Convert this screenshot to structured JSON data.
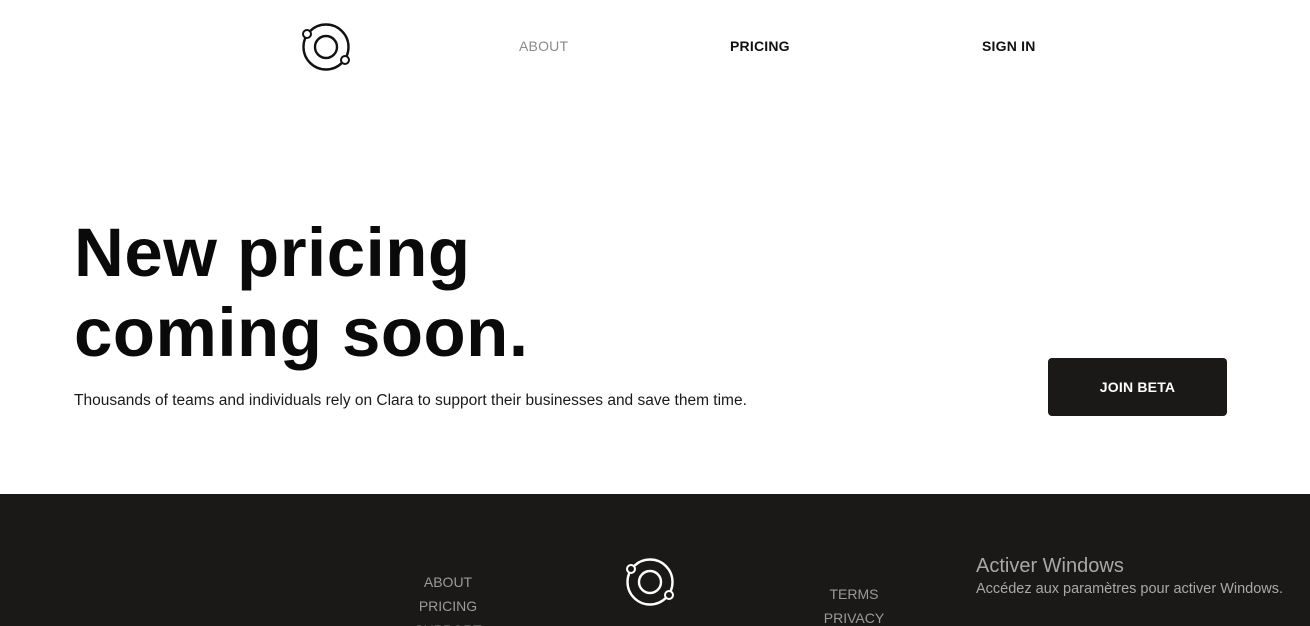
{
  "header": {
    "logo_icon": "orbit-ring-icon",
    "nav": {
      "about": "ABOUT",
      "pricing": "PRICING",
      "sign_in": "SIGN IN"
    }
  },
  "hero": {
    "title_line1": "New pricing",
    "title_line2": "coming soon.",
    "subtitle": "Thousands of teams and individuals rely on Clara to support their businesses and save them time.",
    "cta_label": "JOIN BETA"
  },
  "footer": {
    "logo_icon": "orbit-ring-icon",
    "left_links": [
      "ABOUT",
      "PRICING",
      "SUPPORT"
    ],
    "right_links": [
      "TERMS",
      "PRIVACY"
    ]
  },
  "os_watermark": {
    "title": "Activer Windows",
    "text": "Accédez aux paramètres pour activer Windows."
  },
  "colors": {
    "background": "#ffffff",
    "text": "#111111",
    "muted_nav": "#8a8a8a",
    "dark": "#1b1917",
    "footer_link": "#9a9a9a"
  }
}
